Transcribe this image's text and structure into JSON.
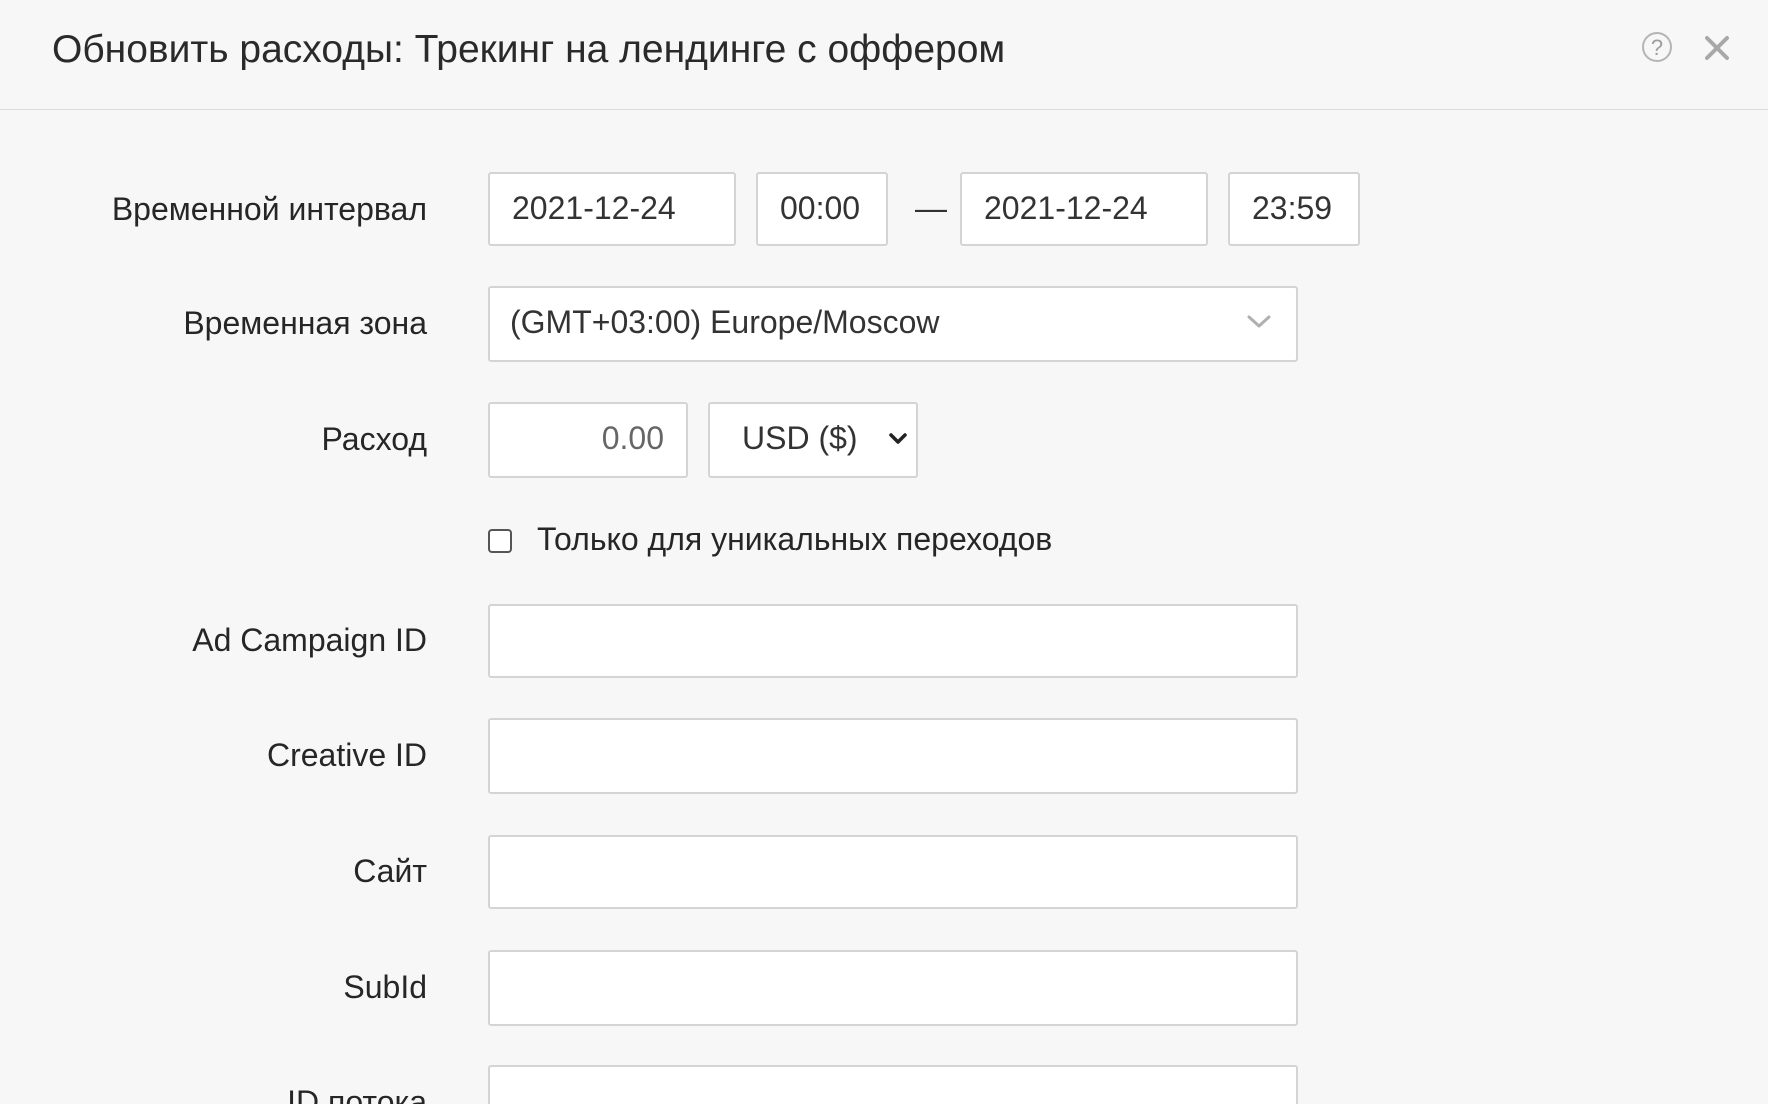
{
  "dialog": {
    "title": "Обновить расходы: Трекинг на лендинге с оффером",
    "help_symbol": "?"
  },
  "form": {
    "interval": {
      "label": "Временной интервал",
      "date_from": "2021-12-24",
      "time_from": "00:00",
      "separator": "—",
      "date_to": "2021-12-24",
      "time_to": "23:59"
    },
    "timezone": {
      "label": "Временная зона",
      "value": "(GMT+03:00) Europe/Moscow"
    },
    "cost": {
      "label": "Расход",
      "placeholder": "0.00",
      "currency": "USD ($)"
    },
    "unique_only": {
      "label": "Только для уникальных переходов",
      "checked": false
    },
    "ad_campaign_id": {
      "label": "Ad Campaign ID",
      "value": ""
    },
    "creative_id": {
      "label": "Creative ID",
      "value": ""
    },
    "site": {
      "label": "Сайт",
      "value": ""
    },
    "subid": {
      "label": "SubId",
      "value": ""
    },
    "stream_id": {
      "label": "ID потока",
      "value": ""
    }
  },
  "colors": {
    "background": "#f7f7f7",
    "border": "#d4d4d4",
    "icon": "#a8a8a8"
  },
  "icons": {
    "help": "question-circle-icon",
    "close": "close-icon",
    "select": "chevron-down-icon"
  }
}
